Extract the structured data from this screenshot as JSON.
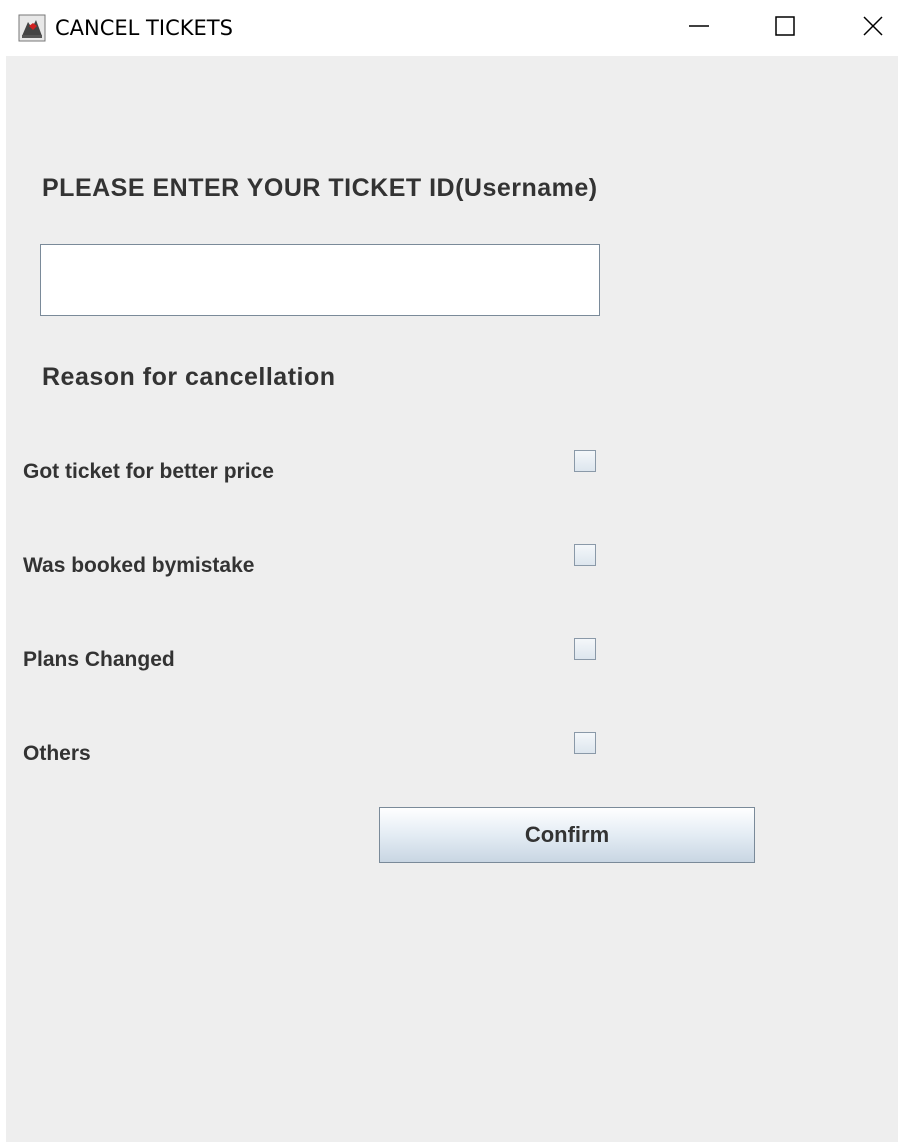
{
  "window": {
    "title": "CANCEL TICKETS",
    "icon": "java-app-icon",
    "controls": {
      "minimize_icon": "minimize-icon",
      "maximize_icon": "maximize-icon",
      "close_icon": "close-icon"
    }
  },
  "form": {
    "ticket_heading": "PLEASE ENTER YOUR TICKET ID(Username)",
    "ticket_value": "",
    "reason_heading": "Reason for cancellation",
    "reasons": [
      {
        "label": "Got ticket for better price",
        "checked": false
      },
      {
        "label": "Was booked bymistake",
        "checked": false
      },
      {
        "label": "Plans Changed",
        "checked": false
      },
      {
        "label": "Others",
        "checked": false
      }
    ],
    "confirm_label": "Confirm"
  },
  "colors": {
    "panel_background": "#eeeeee",
    "text": "#333333",
    "border": "#7a8a99"
  }
}
